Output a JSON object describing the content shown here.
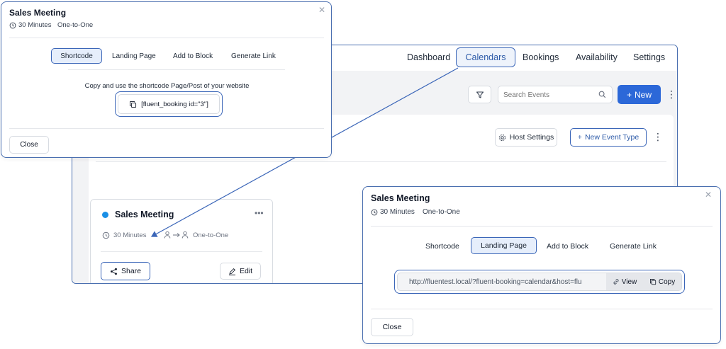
{
  "app": {
    "nav": {
      "dashboard": "Dashboard",
      "calendars": "Calendars",
      "bookings": "Bookings",
      "availability": "Availability",
      "settings": "Settings"
    },
    "toolbar": {
      "search_placeholder": "Search Events",
      "new_label": "New"
    },
    "panel": {
      "host_settings_label": "Host Settings",
      "new_event_type_label": "New Event Type"
    },
    "event_card": {
      "title": "Sales Meeting",
      "duration": "30 Minutes",
      "type": "One-to-One",
      "share_label": "Share",
      "edit_label": "Edit",
      "status_color": "#1a8fe6"
    }
  },
  "share_modal_shortcode": {
    "title": "Sales Meeting",
    "duration": "30 Minutes",
    "type": "One-to-One",
    "tabs": [
      "Shortcode",
      "Landing Page",
      "Add to Block",
      "Generate Link"
    ],
    "active_tab": "Shortcode",
    "instruction": "Copy and use the shortcode Page/Post of your website",
    "shortcode": "[fluent_booking id=\"3\"]",
    "close_label": "Close"
  },
  "share_modal_landing": {
    "title": "Sales Meeting",
    "duration": "30 Minutes",
    "type": "One-to-One",
    "tabs": [
      "Shortcode",
      "Landing Page",
      "Add to Block",
      "Generate Link"
    ],
    "active_tab": "Landing Page",
    "url": "http://fluentest.local/?fluent-booking=calendar&host=flu",
    "view_label": "View",
    "copy_label": "Copy",
    "close_label": "Close"
  },
  "colors": {
    "accent": "#2c68d8",
    "highlight_border": "#3b66b8",
    "active_tab_bg": "#e6eefb"
  }
}
